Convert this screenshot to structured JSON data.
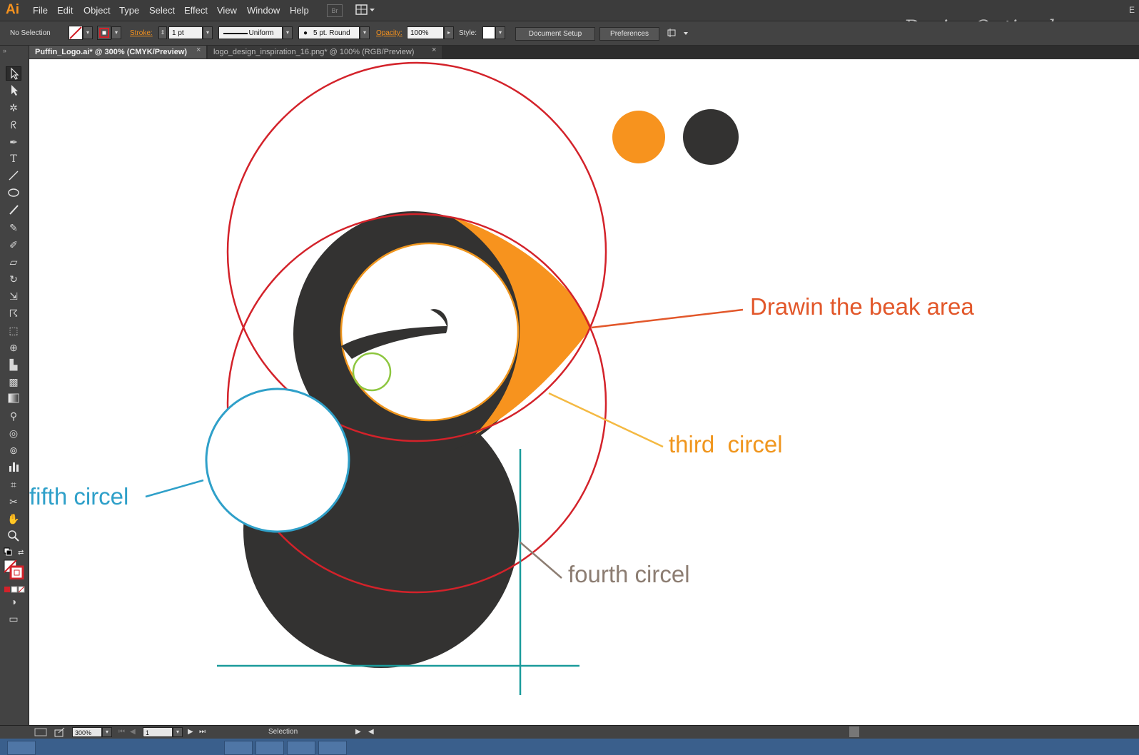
{
  "app": {
    "logo": "Ai",
    "menu": [
      "File",
      "Edit",
      "Object",
      "Type",
      "Select",
      "Effect",
      "View",
      "Window",
      "Help"
    ],
    "bridge_label": "Br",
    "watermark": "DesignOptimal.com",
    "corner_letter": "E"
  },
  "control_bar": {
    "selection_status": "No Selection",
    "stroke_label": "Stroke:",
    "stroke_weight": "1 pt",
    "stroke_profile": "Uniform",
    "brush": "5 pt. Round",
    "opacity_label": "Opacity:",
    "opacity_value": "100%",
    "style_label": "Style:",
    "document_setup": "Document Setup",
    "preferences": "Preferences"
  },
  "tabs": [
    {
      "label": "Puffin_Logo.ai* @ 300% (CMYK/Preview)",
      "active": true
    },
    {
      "label": "logo_design_inspiration_16.png* @ 100% (RGB/Preview)",
      "active": false
    }
  ],
  "tools": [
    "selection",
    "direct-selection",
    "magic-wand",
    "lasso",
    "pen",
    "type",
    "line-segment",
    "ellipse",
    "paintbrush",
    "pencil",
    "blob-brush",
    "eraser",
    "rotate",
    "scale",
    "warp",
    "free-transform",
    "shape-builder",
    "perspective-grid",
    "mesh",
    "gradient",
    "eyedropper",
    "blend",
    "symbol-sprayer",
    "column-graph",
    "artboard",
    "slice",
    "hand",
    "zoom"
  ],
  "annotations": {
    "beak": {
      "text": "Drawin the beak area",
      "color": "#e2572a"
    },
    "third": {
      "text": "third  circel",
      "color": "#f0961e"
    },
    "fifth": {
      "text": "fifth circel",
      "color": "#2fa0c9"
    },
    "fourth": {
      "text": "fourth circel",
      "color": "#8c7d72"
    }
  },
  "colors": {
    "orange_swatch": "#f7931e",
    "dark_swatch": "#333231",
    "construction_red": "#d3222a",
    "guide_teal": "#1a9b9b",
    "eye_green": "#8dc63f",
    "circle_orange": "#f0961e",
    "circle_blue": "#2fa0c9"
  },
  "status_bar": {
    "zoom": "300%",
    "artboard": "1",
    "tool": "Selection"
  }
}
